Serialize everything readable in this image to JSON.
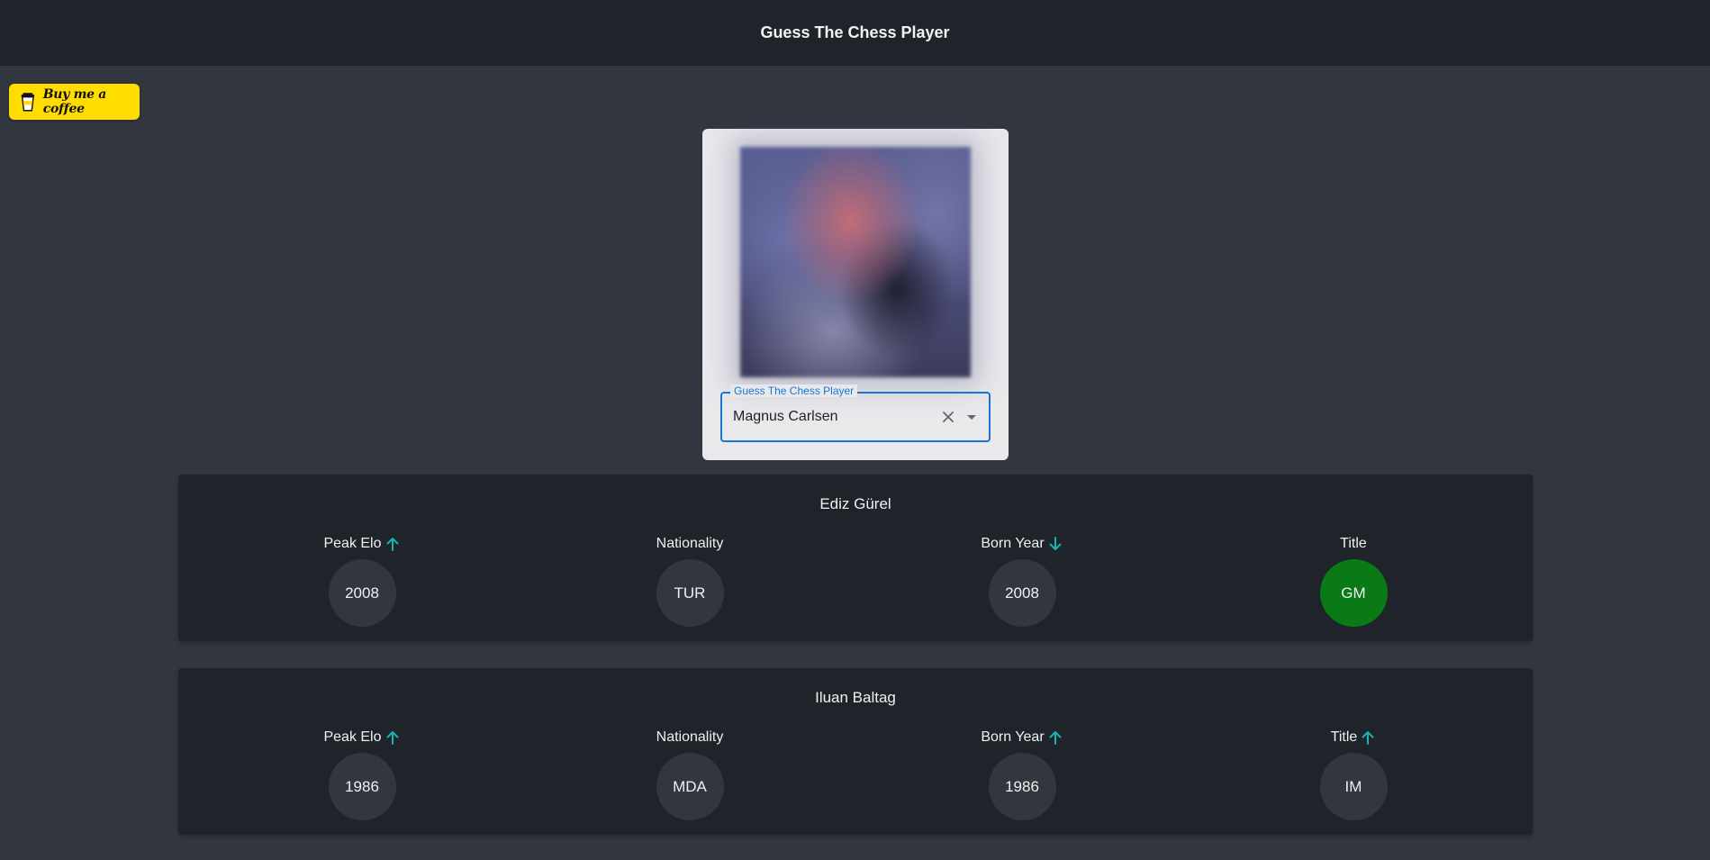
{
  "header": {
    "title": "Guess The Chess Player"
  },
  "coffee": {
    "label": "Buy me a coffee",
    "color": "#ffdd00"
  },
  "guess": {
    "field_label": "Guess The Chess Player",
    "value": "Magnus Carlsen",
    "accent": "#1976d2"
  },
  "icons": {
    "clear": "close-icon",
    "dropdown": "caret-down-icon",
    "up": "arrow-up-icon",
    "down": "arrow-down-icon",
    "arrow_color": "#1ab3b3",
    "correct_color": "#0a7a16"
  },
  "guesses": [
    {
      "name": "Ediz Gürel",
      "attributes": [
        {
          "label": "Peak Elo",
          "value": "2008",
          "hint": "up",
          "correct": false
        },
        {
          "label": "Nationality",
          "value": "TUR",
          "hint": "none",
          "correct": false
        },
        {
          "label": "Born Year",
          "value": "2008",
          "hint": "down",
          "correct": false
        },
        {
          "label": "Title",
          "value": "GM",
          "hint": "none",
          "correct": true
        }
      ]
    },
    {
      "name": "Iluan Baltag",
      "attributes": [
        {
          "label": "Peak Elo",
          "value": "1986",
          "hint": "up",
          "correct": false
        },
        {
          "label": "Nationality",
          "value": "MDA",
          "hint": "none",
          "correct": false
        },
        {
          "label": "Born Year",
          "value": "1986",
          "hint": "up",
          "correct": false
        },
        {
          "label": "Title",
          "value": "IM",
          "hint": "up",
          "correct": false
        }
      ]
    }
  ]
}
